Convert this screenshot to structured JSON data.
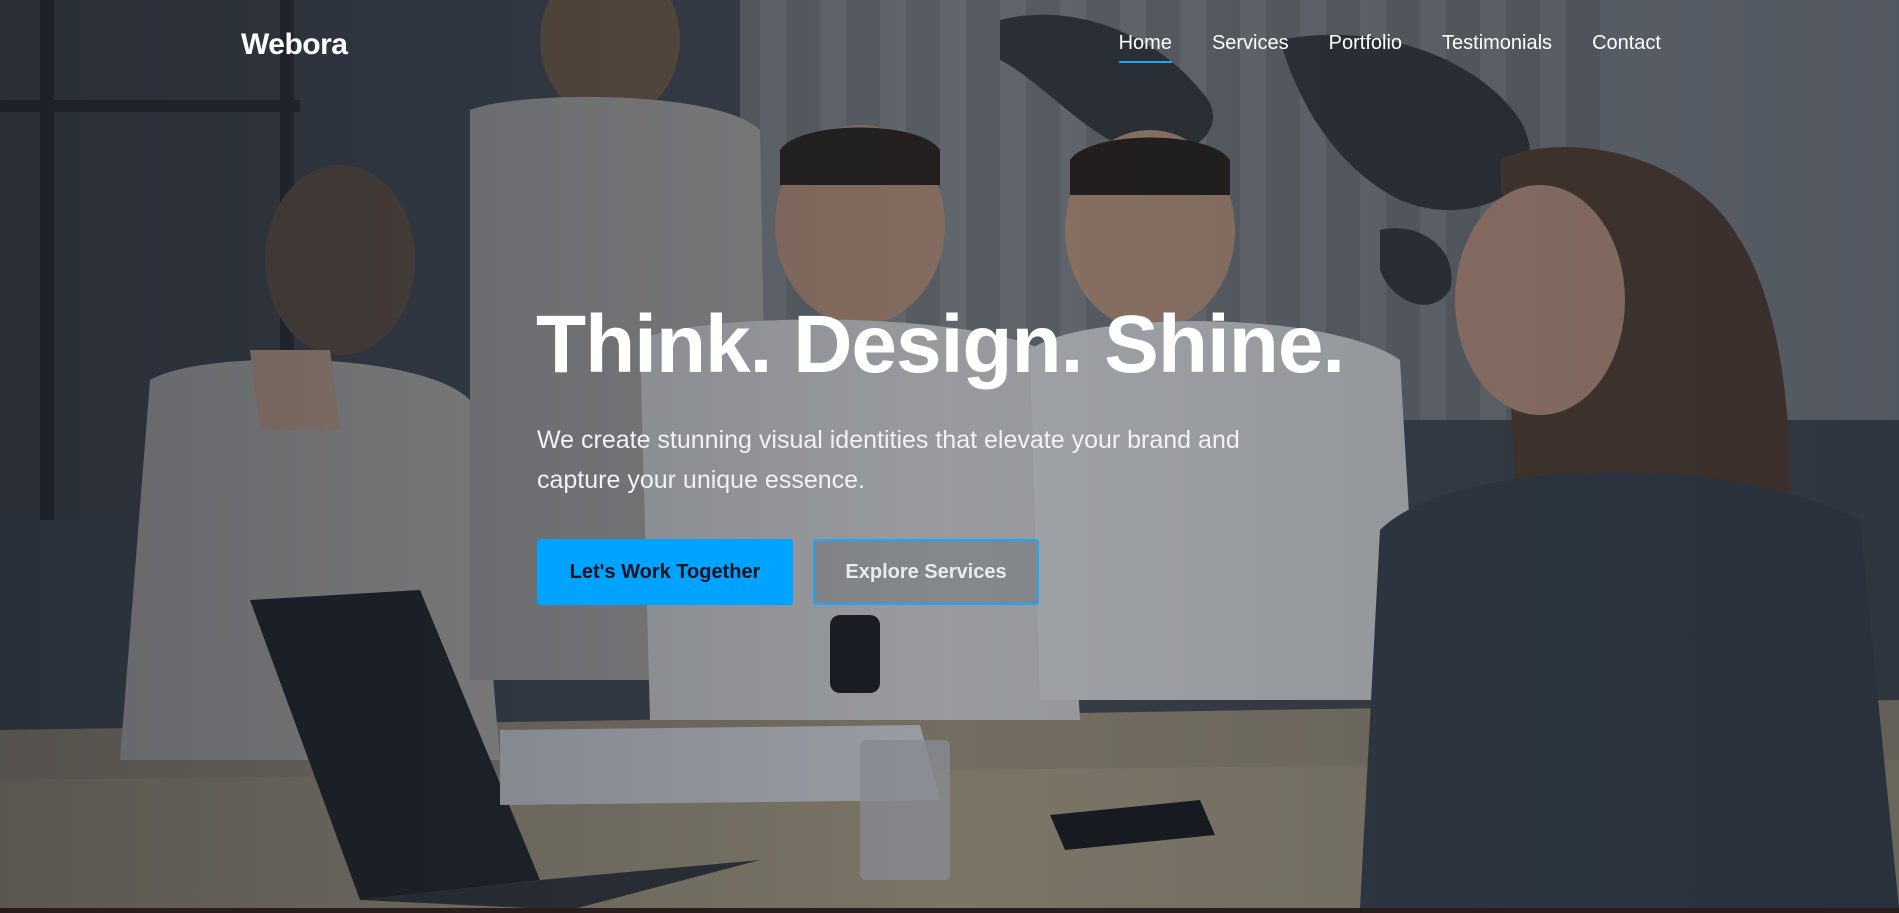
{
  "brand": {
    "logo_text": "Webora",
    "accent_color": "#00a3ff"
  },
  "nav": {
    "items": [
      {
        "label": "Home",
        "active": true
      },
      {
        "label": "Services",
        "active": false
      },
      {
        "label": "Portfolio",
        "active": false
      },
      {
        "label": "Testimonials",
        "active": false
      },
      {
        "label": "Contact",
        "active": false
      }
    ]
  },
  "hero": {
    "headline": "Think. Design. Shine.",
    "subline": "We create stunning visual identities that elevate your brand and capture your unique essence.",
    "primary_button": "Let's Work Together",
    "secondary_button": "Explore Services",
    "background_image": "team meeting photo with laptop, world map wall"
  }
}
